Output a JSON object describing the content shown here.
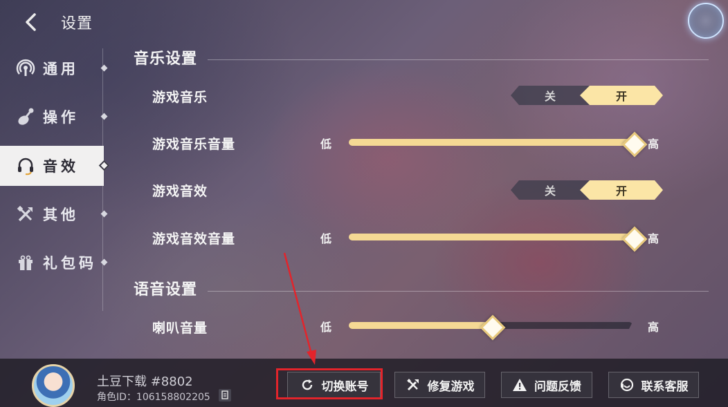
{
  "header": {
    "title": "设置",
    "back_icon": "chevron-left-icon"
  },
  "sidebar": {
    "items": [
      {
        "label": "通用",
        "icon": "broadcast-icon",
        "active": false
      },
      {
        "label": "操作",
        "icon": "joystick-icon",
        "active": false
      },
      {
        "label": "音效",
        "icon": "headset-icon",
        "active": true
      },
      {
        "label": "其他",
        "icon": "tools-icon",
        "active": false
      },
      {
        "label": "礼包码",
        "icon": "gift-icon",
        "active": false
      }
    ]
  },
  "music_section": {
    "title": "音乐设置",
    "game_music": {
      "label": "游戏音乐",
      "off_label": "关",
      "on_label": "开",
      "value": "开"
    },
    "game_music_volume": {
      "label": "游戏音乐音量",
      "low": "低",
      "high": "高",
      "level": 1.0
    },
    "game_sfx": {
      "label": "游戏音效",
      "off_label": "关",
      "on_label": "开",
      "value": "开"
    },
    "game_sfx_volume": {
      "label": "游戏音效音量",
      "low": "低",
      "high": "高",
      "level": 1.0
    }
  },
  "voice_section": {
    "title": "语音设置",
    "speaker_volume": {
      "label": "喇叭音量",
      "low": "低",
      "high": "高",
      "level": 0.5
    }
  },
  "profile": {
    "name": "土豆下载 #8802",
    "role_id": "角色ID：106158802205"
  },
  "bottom_buttons": {
    "switch_account": "切换账号",
    "repair_game": "修复游戏",
    "feedback": "问题反馈",
    "support": "联系客服"
  },
  "annotation_color": "#e3242b",
  "accent_color": "#fbe5a6"
}
